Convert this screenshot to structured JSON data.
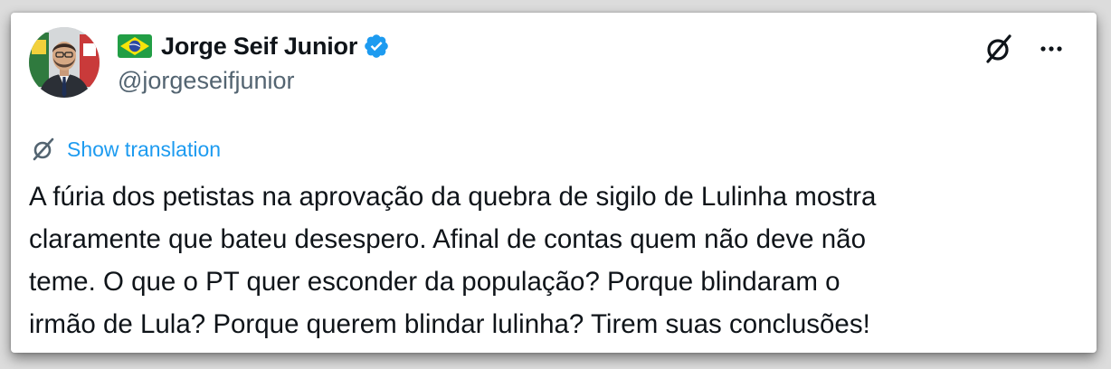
{
  "author": {
    "flag_icon": "brazil-flag-icon",
    "name": "Jorge Seif Junior",
    "verified_icon": "verified-badge-icon",
    "verified_color": "#1d9bf0",
    "handle": "@jorgeseifjunior",
    "avatar_icon": "avatar-photo"
  },
  "actions": {
    "grok_icon": "grok-icon",
    "more_icon": "more-options-icon"
  },
  "translation": {
    "icon": "grok-icon",
    "label": "Show translation",
    "color": "#1d9bf0"
  },
  "tweet": {
    "lines": [
      "A fúria dos petistas na aprovação da quebra de sigilo de Lulinha mostra",
      "claramente que bateu desespero. Afinal de contas quem não deve não",
      "teme. O que o PT quer esconder da população? Porque blindaram o",
      "irmão de Lula? Porque querem blindar lulinha? Tirem suas conclusões!"
    ]
  }
}
